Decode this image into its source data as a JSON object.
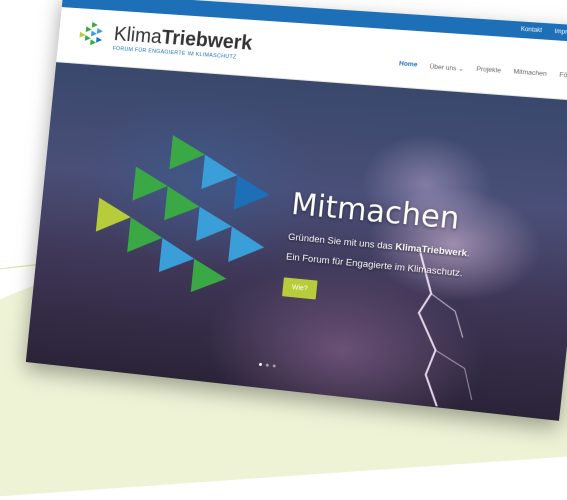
{
  "topbar": {
    "links": [
      "Kontakt",
      "Impressum"
    ]
  },
  "logo": {
    "name_light": "Klima",
    "name_bold": "Triebwerk",
    "tagline": "FORUM FÜR ENGAGIERTE IM KLIMASCHUTZ"
  },
  "nav": {
    "items": [
      "Home",
      "Über uns ⌄",
      "Projekte",
      "Mitmachen",
      "Fördern"
    ],
    "active_index": 0
  },
  "hero": {
    "title": "Mitmachen",
    "line1_prefix": "Gründen Sie mit uns das ",
    "line1_bold": "KlimaTriebwerk",
    "line1_suffix": ".",
    "line2": "Ein Forum für Engagierte im Klimaschutz.",
    "cta": "Wie?"
  },
  "slider": {
    "count": 3,
    "active": 0
  },
  "colors": {
    "primary_blue": "#1d6fb8",
    "lime": "#b7cc3a",
    "green": "#3aa845",
    "sky": "#3a9ed8",
    "background_green": "#eef3d6"
  }
}
